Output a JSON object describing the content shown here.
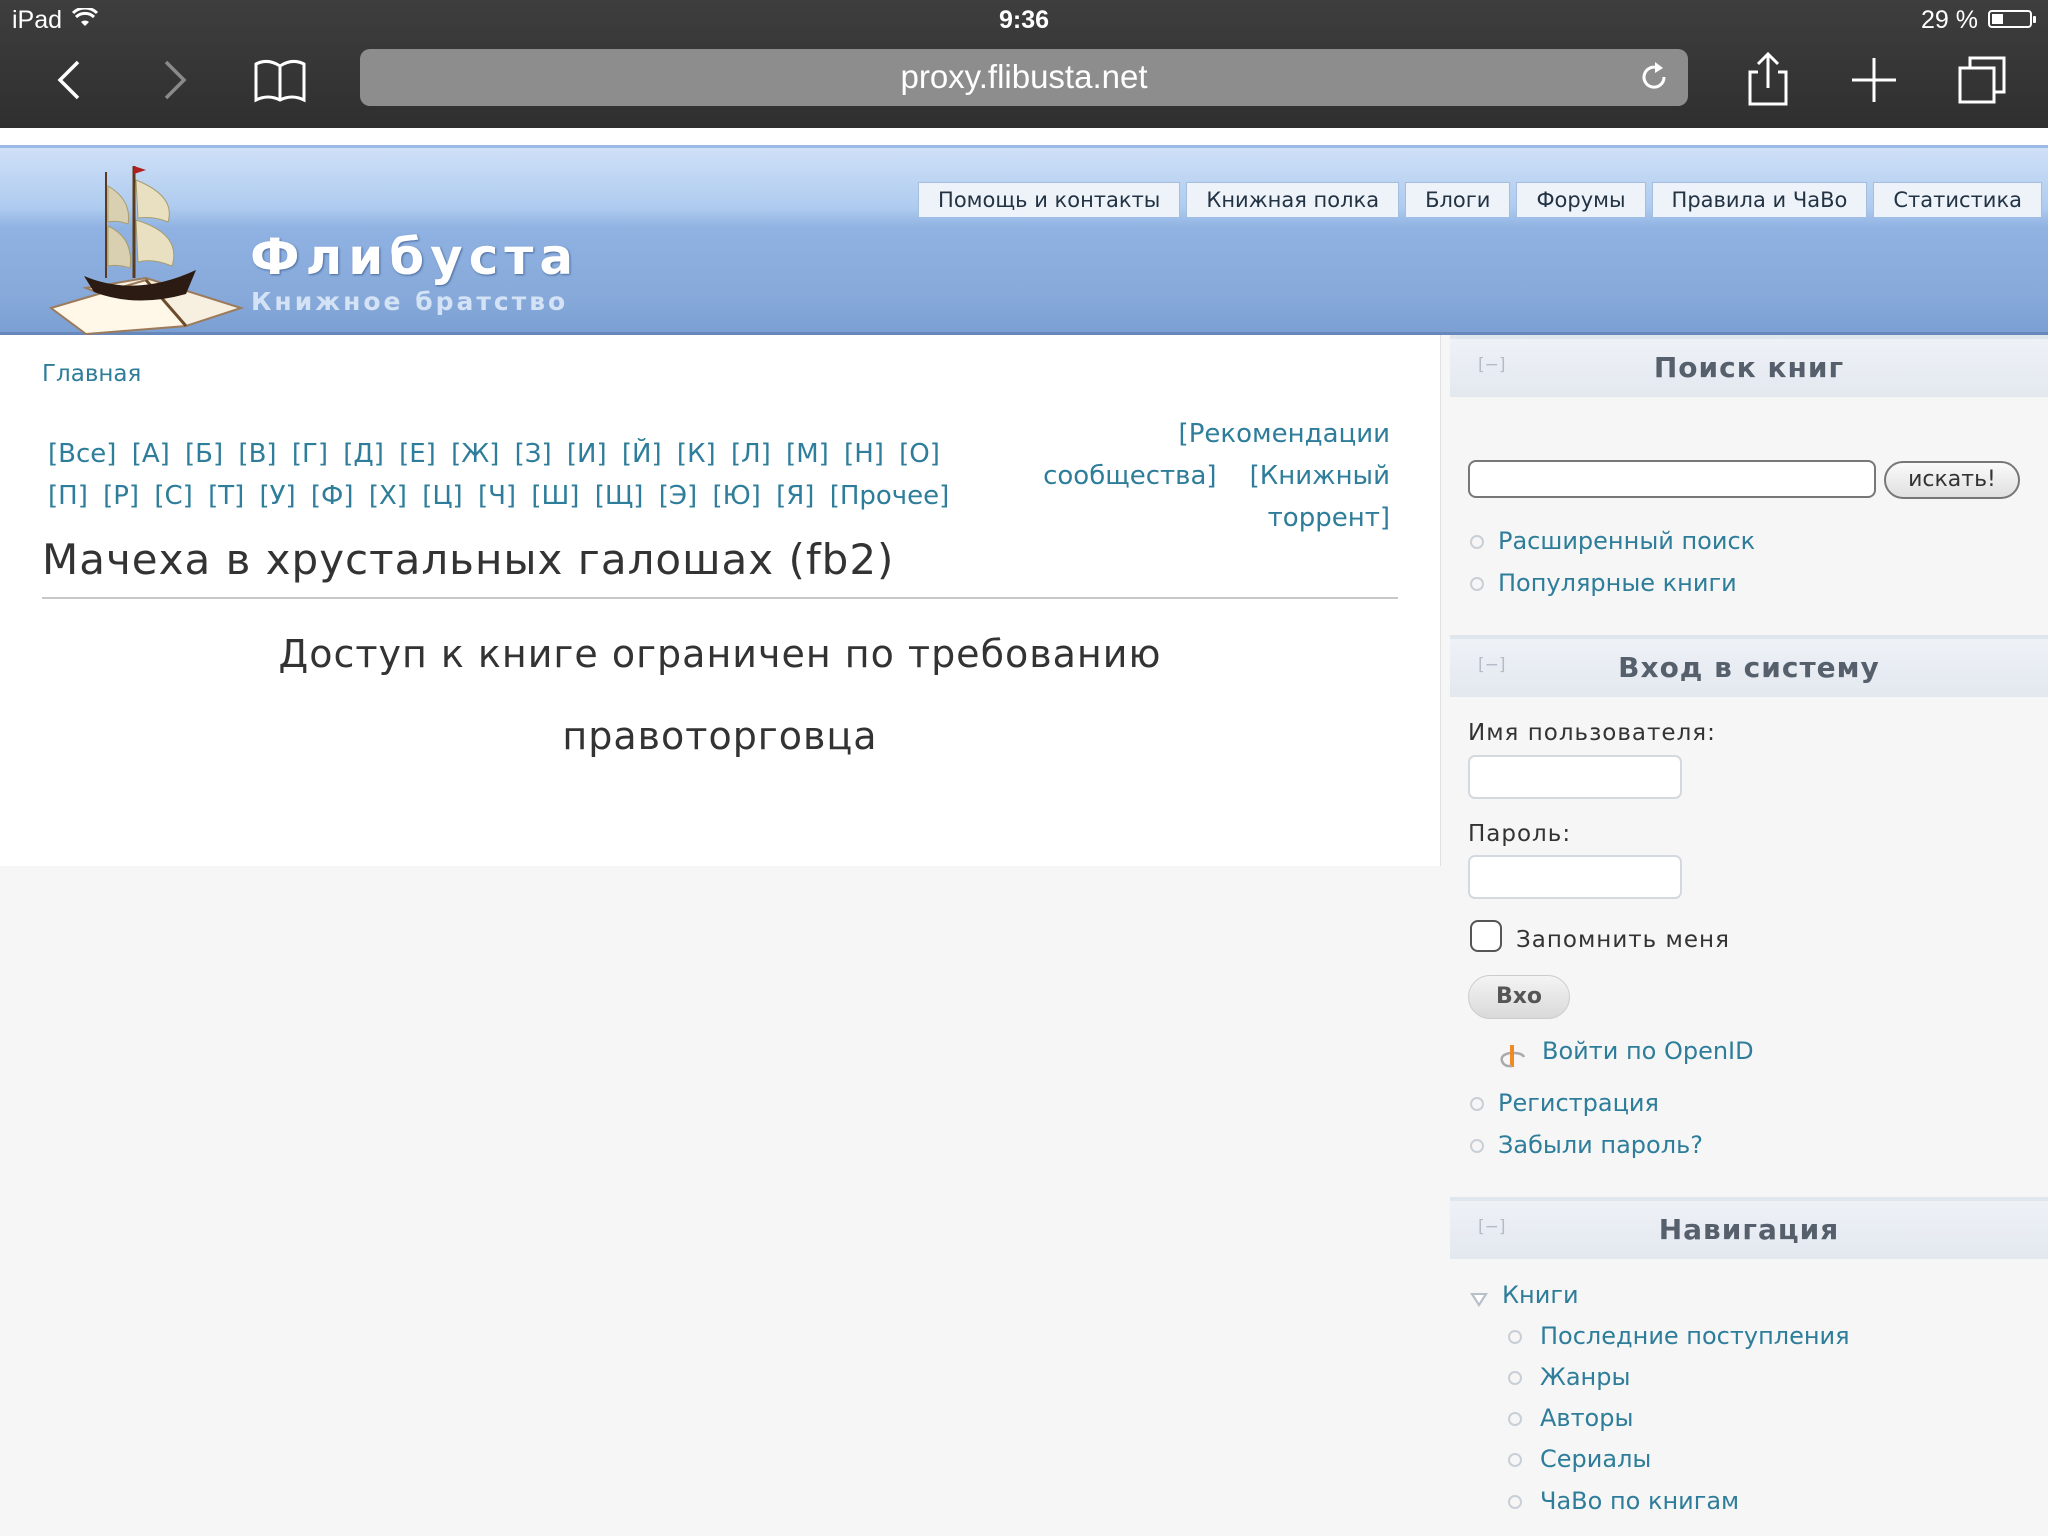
{
  "status_bar": {
    "device": "iPad",
    "time": "9:36",
    "battery": "29 %",
    "battery_level": 0.29
  },
  "browser": {
    "url": "proxy.flibusta.net",
    "icons": [
      "back-icon",
      "forward-icon",
      "bookmarks-icon",
      "reload-icon",
      "share-icon",
      "new-tab-icon",
      "tabs-icon"
    ]
  },
  "site": {
    "name": "Флибуста",
    "slogan": "Книжное братство",
    "topnav": [
      "Помощь и контакты",
      "Книжная полка",
      "Блоги",
      "Форумы",
      "Правила и ЧаВо",
      "Статистика"
    ]
  },
  "main": {
    "breadcrumb": "Главная",
    "alphabet": [
      "[Все]",
      "[А]",
      "[Б]",
      "[В]",
      "[Г]",
      "[Д]",
      "[Е]",
      "[Ж]",
      "[З]",
      "[И]",
      "[Й]",
      "[К]",
      "[Л]",
      "[М]",
      "[Н]",
      "[О]",
      "[П]",
      "[Р]",
      "[С]",
      "[Т]",
      "[У]",
      "[Ф]",
      "[Х]",
      "[Ц]",
      "[Ч]",
      "[Ш]",
      "[Щ]",
      "[Э]",
      "[Ю]",
      "[Я]",
      "[Прочее]"
    ],
    "promo_line1": "[Рекомендации",
    "promo_line2a": "сообщества]",
    "promo_line2b": "[Книжный",
    "promo_line3": "торрент]",
    "book_title": "Мачеха в хрустальных галошах (fb2)",
    "restricted_line1": "Доступ к книге ограничен по требованию",
    "restricted_line2": "правоторговца"
  },
  "sidebar": {
    "collapse_label": "[−]",
    "search": {
      "title": "Поиск книг",
      "button": "искать!",
      "value": "",
      "links": [
        "Расширенный поиск",
        "Популярные книги"
      ]
    },
    "login": {
      "title": "Вход в систему",
      "username_label": "Имя пользователя:",
      "password_label": "Пароль:",
      "remember": "Запомнить меня",
      "button": "Вхо",
      "openid": "Войти по OpenID",
      "links": [
        "Регистрация",
        "Забыли пароль?"
      ]
    },
    "navigation": {
      "title": "Навигация",
      "books": "Книги",
      "items": [
        "Последние поступления",
        "Жанры",
        "Авторы",
        "Сериалы",
        "ЧаВо по книгам"
      ]
    }
  }
}
